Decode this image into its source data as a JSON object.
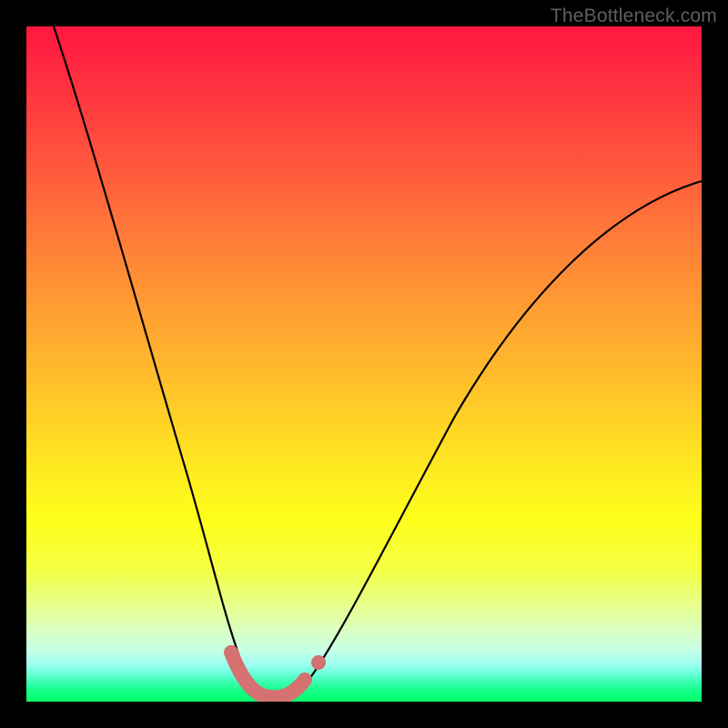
{
  "watermark": "TheBottleneck.com",
  "chart_data": {
    "type": "line",
    "title": "",
    "xlabel": "",
    "ylabel": "",
    "xlim": [
      0,
      100
    ],
    "ylim": [
      0,
      100
    ],
    "grid": false,
    "series": [
      {
        "name": "bottleneck-curve",
        "x": [
          4,
          8,
          12,
          16,
          20,
          24,
          27,
          29,
          31,
          33,
          35,
          38,
          42,
          46,
          52,
          58,
          65,
          73,
          82,
          92,
          100
        ],
        "y": [
          100,
          86,
          73,
          60,
          48,
          35,
          23,
          14,
          6,
          2,
          1,
          1,
          3,
          7,
          14,
          23,
          33,
          44,
          56,
          68,
          77
        ]
      }
    ],
    "highlight_band": {
      "name": "optimal-range",
      "x": [
        29,
        31,
        33,
        35,
        37,
        39,
        41
      ],
      "y": [
        6,
        2,
        1,
        1,
        1,
        2,
        3
      ]
    },
    "marker_point": {
      "x": 43,
      "y": 5
    },
    "background_gradient": [
      "#ff173f",
      "#ffde23",
      "#06ff6c"
    ]
  }
}
